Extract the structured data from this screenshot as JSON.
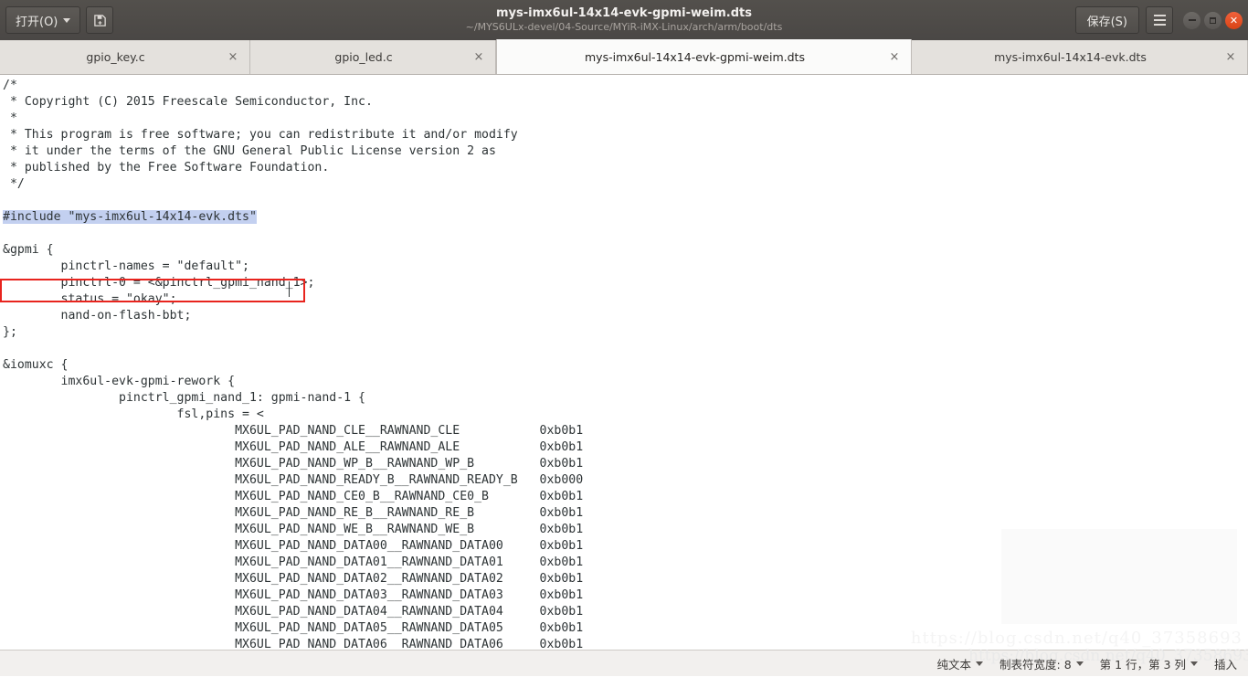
{
  "titlebar": {
    "open_label": "打开(O)",
    "open_icon": "chevron-down-icon",
    "newdoc_icon": "save-as-icon",
    "title": "mys-imx6ul-14x14-evk-gpmi-weim.dts",
    "subtitle": "~/MYS6ULx-devel/04-Source/MYiR-iMX-Linux/arch/arm/boot/dts",
    "save_label": "保存(S)",
    "menu_icon": "hamburger-menu-icon",
    "minimize_icon": "minimize-icon",
    "maximize_icon": "maximize-icon",
    "close_icon": "close-icon",
    "bg_color": "#4e4b48",
    "accent_close": "#d94315"
  },
  "tabs": [
    {
      "label": "gpio_key.c",
      "active": false,
      "close": "×"
    },
    {
      "label": "gpio_led.c",
      "active": false,
      "close": "×"
    },
    {
      "label": "mys-imx6ul-14x14-evk-gpmi-weim.dts",
      "active": true,
      "close": "×"
    },
    {
      "label": "mys-imx6ul-14x14-evk.dts",
      "active": false,
      "close": "×"
    }
  ],
  "editor": {
    "code_before": "/*\n * Copyright (C) 2015 Freescale Semiconductor, Inc.\n *\n * This program is free software; you can redistribute it and/or modify\n * it under the terms of the GNU General Public License version 2 as\n * published by the Free Software Foundation.\n */\n\n",
    "highlighted_line": "#include \"mys-imx6ul-14x14-evk.dts\"",
    "code_after": "\n\n&gpmi {\n        pinctrl-names = \"default\";\n        pinctrl-0 = <&pinctrl_gpmi_nand_1>;\n        status = \"okay\";\n        nand-on-flash-bbt;\n};\n\n&iomuxc {\n        imx6ul-evk-gpmi-rework {\n                pinctrl_gpmi_nand_1: gpmi-nand-1 {\n                        fsl,pins = <\n                                MX6UL_PAD_NAND_CLE__RAWNAND_CLE           0xb0b1\n                                MX6UL_PAD_NAND_ALE__RAWNAND_ALE           0xb0b1\n                                MX6UL_PAD_NAND_WP_B__RAWNAND_WP_B         0xb0b1\n                                MX6UL_PAD_NAND_READY_B__RAWNAND_READY_B   0xb000\n                                MX6UL_PAD_NAND_CE0_B__RAWNAND_CE0_B       0xb0b1\n                                MX6UL_PAD_NAND_RE_B__RAWNAND_RE_B         0xb0b1\n                                MX6UL_PAD_NAND_WE_B__RAWNAND_WE_B         0xb0b1\n                                MX6UL_PAD_NAND_DATA00__RAWNAND_DATA00     0xb0b1\n                                MX6UL_PAD_NAND_DATA01__RAWNAND_DATA01     0xb0b1\n                                MX6UL_PAD_NAND_DATA02__RAWNAND_DATA02     0xb0b1\n                                MX6UL_PAD_NAND_DATA03__RAWNAND_DATA03     0xb0b1\n                                MX6UL_PAD_NAND_DATA04__RAWNAND_DATA04     0xb0b1\n                                MX6UL_PAD_NAND_DATA05__RAWNAND_DATA05     0xb0b1\n                                MX6UL_PAD_NAND_DATA06__RAWNAND_DATA06     0xb0b1",
    "highlight_color": "#c3d0f0",
    "annotation_box_color": "#e8241e",
    "watermark": "https://blog.csdn.net/q40_37358693"
  },
  "statusbar": {
    "filetype": "纯文本",
    "tabwidth": "制表符宽度: 8",
    "position": "第 1 行，第 3 列",
    "insert_mode": "插入"
  }
}
